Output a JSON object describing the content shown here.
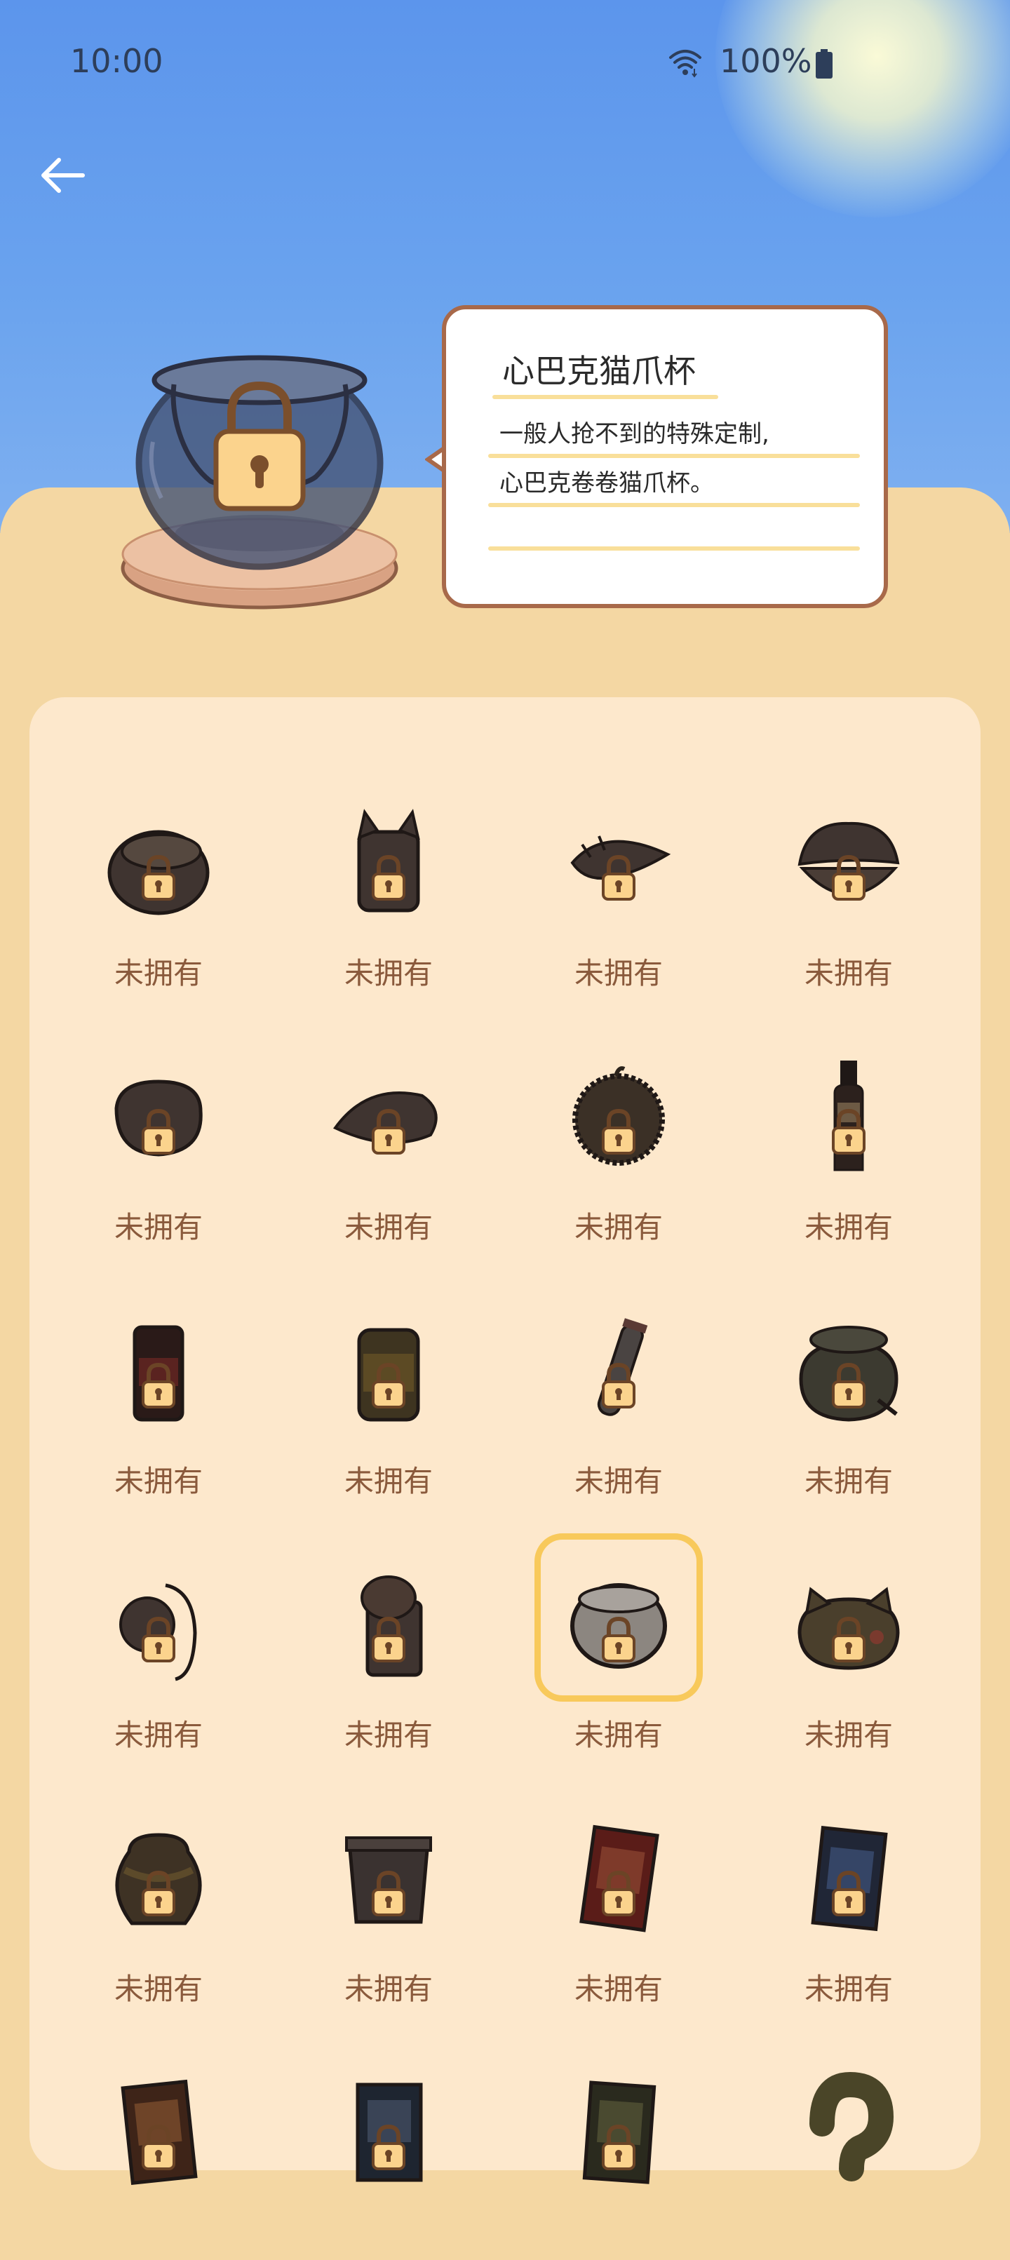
{
  "status_bar": {
    "time": "10:00",
    "battery": "100%"
  },
  "detail": {
    "name": "心巴克猫爪杯",
    "description_lines": [
      "一般人抢不到的特殊定制,",
      "心巴克卷卷猫爪杯。"
    ]
  },
  "grid": {
    "items": [
      {
        "status": "未拥有",
        "icon": "bowl-icon"
      },
      {
        "status": "未拥有",
        "icon": "cat-cup-icon"
      },
      {
        "status": "未拥有",
        "icon": "conch-shell-icon"
      },
      {
        "status": "未拥有",
        "icon": "clam-shell-icon"
      },
      {
        "status": "未拥有",
        "icon": "pouch-icon"
      },
      {
        "status": "未拥有",
        "icon": "leaf-shell-icon"
      },
      {
        "status": "未拥有",
        "icon": "durian-icon"
      },
      {
        "status": "未拥有",
        "icon": "wine-bottle-icon"
      },
      {
        "status": "未拥有",
        "icon": "soda-can-icon"
      },
      {
        "status": "未拥有",
        "icon": "tin-can-icon"
      },
      {
        "status": "未拥有",
        "icon": "test-tube-icon"
      },
      {
        "status": "未拥有",
        "icon": "clay-pot-icon"
      },
      {
        "status": "未拥有",
        "icon": "gourd-icon"
      },
      {
        "status": "未拥有",
        "icon": "mushroom-jar-icon"
      },
      {
        "status": "未拥有",
        "icon": "cat-paw-cup-icon",
        "selected": true
      },
      {
        "status": "未拥有",
        "icon": "cat-head-cup-icon"
      },
      {
        "status": "未拥有",
        "icon": "vase-icon"
      },
      {
        "status": "未拥有",
        "icon": "square-pot-icon"
      },
      {
        "status": "未拥有",
        "icon": "red-book-icon"
      },
      {
        "status": "未拥有",
        "icon": "blue-book-icon"
      },
      {
        "status": "",
        "icon": "orange-book-icon"
      },
      {
        "status": "",
        "icon": "dark-book-icon"
      },
      {
        "status": "",
        "icon": "green-book-icon"
      },
      {
        "status": "",
        "icon": "question-mark-icon"
      }
    ]
  }
}
